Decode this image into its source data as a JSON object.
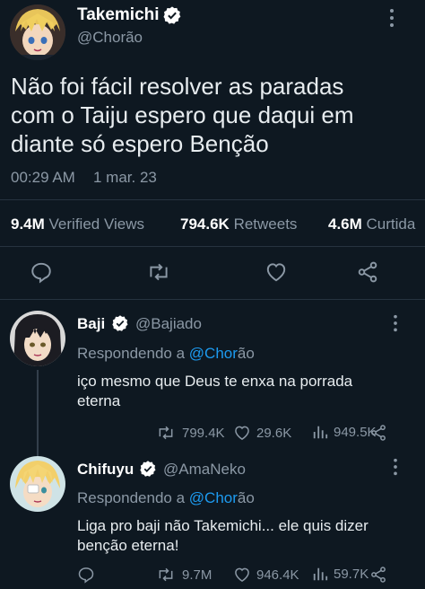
{
  "main_tweet": {
    "display_name": "Takemichi",
    "handle": "@Chorão",
    "text_line1": "Não foi fácil resolver as paradas",
    "text_line2": "com o Taiju espero que daqui em",
    "text_line3": "diante só espero Benção",
    "time": "00:29 AM",
    "date": "1 mar. 23",
    "views_count": "9.4M",
    "views_label": "Verified Views",
    "retweets_count": "794.6K",
    "retweets_label": "Retweets",
    "likes_count": "4.6M",
    "likes_label": "Curtida"
  },
  "replies": [
    {
      "display_name": "Baji",
      "handle": "@Bajiado",
      "replying_prefix": "Respondendo a",
      "replying_to_a": "@Chor",
      "replying_to_b": "ão",
      "text_line1": "iço mesmo que Deus te enxa na porrada",
      "text_line2": "eterna",
      "retweets": "799.4K",
      "likes": "29.6K",
      "views": "949.5K"
    },
    {
      "display_name": "Chifuyu",
      "handle": "@AmaNeko",
      "replying_prefix": "Respondendo a",
      "replying_to_a": "@Chor",
      "replying_to_b": "ão",
      "text_line1": "Liga pro baji não Takemichi... ele quis dizer",
      "text_line2": "benção eterna!",
      "retweets": "9.7M",
      "likes": "946.4K",
      "views": "59.7K"
    }
  ],
  "colors": {
    "background": "#0e1821",
    "accent": "#1d9bf0",
    "muted": "#8b98a5"
  },
  "icons": [
    "verified-badge-icon",
    "more-icon",
    "reply-icon",
    "retweet-icon",
    "like-icon",
    "share-icon",
    "views-icon"
  ]
}
